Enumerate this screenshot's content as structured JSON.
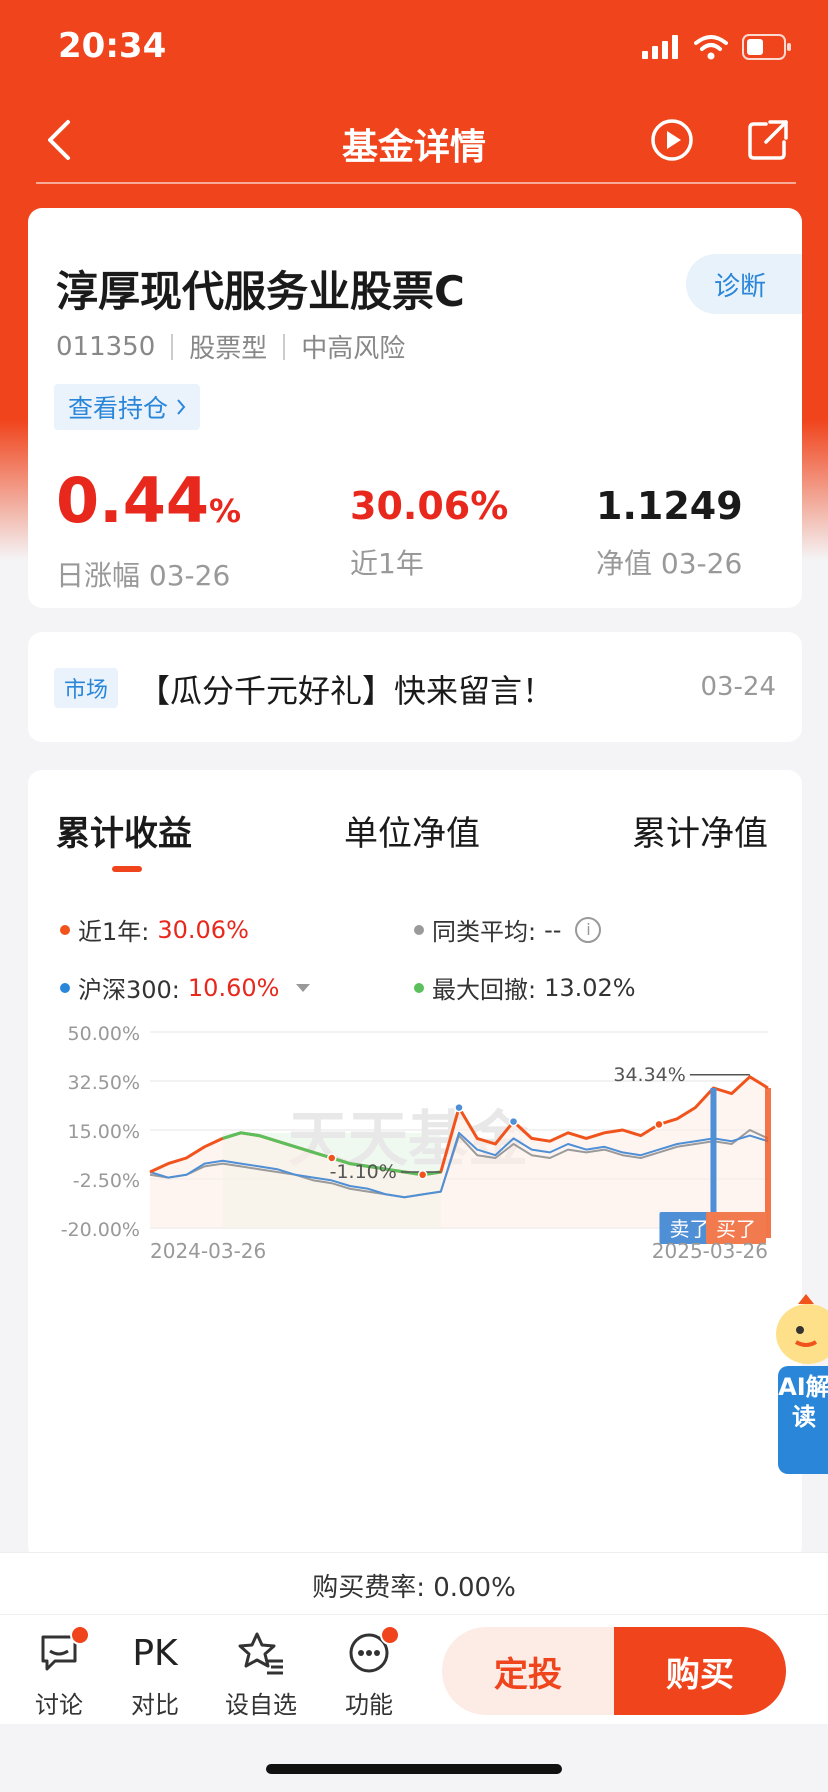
{
  "status": {
    "time": "20:34"
  },
  "nav": {
    "title": "基金详情",
    "back_icon": "chevron-left-icon",
    "play_icon": "play-circle-icon",
    "share_icon": "share-icon"
  },
  "fund": {
    "name": "淳厚现代服务业股票C",
    "code": "011350",
    "type": "股票型",
    "risk": "中高风险",
    "diagnose_label": "诊断",
    "holdings_label": "查看持仓"
  },
  "stats": {
    "daily_change": "0.44",
    "daily_change_unit": "%",
    "daily_change_label": "日涨幅 03-26",
    "one_year": "30.06%",
    "one_year_label": "近1年",
    "nav": "1.1249",
    "nav_label": "净值 03-26"
  },
  "news": {
    "tag": "市场",
    "title": "【瓜分千元好礼】快来留言！",
    "date": "03-24"
  },
  "chart_tabs": [
    "累计收益",
    "单位净值",
    "累计净值"
  ],
  "legend": {
    "fund_label": "近1年:",
    "fund_value": "30.06%",
    "peer_label": "同类平均:",
    "peer_value": "--",
    "index_label": "沪深300:",
    "index_value": "10.60%",
    "drawdown_label": "最大回撤:",
    "drawdown_value": "13.02%"
  },
  "chart_extra": {
    "watermark": "天天基金",
    "peak_label": "34.34%",
    "trough_label": "-1.10%",
    "sell_label": "卖了",
    "buy_label": "买了",
    "ai_label": "AI解读"
  },
  "chart_data": {
    "type": "line",
    "x_start": "2024-03-26",
    "x_end": "2025-03-26",
    "ylim": [
      -20,
      50
    ],
    "yticks": [
      "50.00%",
      "32.50%",
      "15.00%",
      "-2.50%",
      "-20.00%"
    ],
    "series": [
      {
        "name": "近1年",
        "color": "#f0541c",
        "values": [
          0,
          3,
          5,
          9,
          12,
          14,
          13,
          11,
          9,
          7,
          5,
          3,
          2,
          1,
          0,
          -1,
          0,
          23,
          12,
          10,
          18,
          12,
          11,
          14,
          12,
          14,
          15,
          13,
          17,
          19,
          23,
          30,
          28,
          34,
          30
        ]
      },
      {
        "name": "沪深300",
        "color": "#4f8fd6",
        "values": [
          0,
          -2,
          -1,
          3,
          4,
          3,
          2,
          1,
          -1,
          -2,
          -3,
          -5,
          -6,
          -8,
          -9,
          -8,
          -7,
          14,
          8,
          6,
          12,
          8,
          7,
          10,
          8,
          9,
          7,
          6,
          8,
          10,
          11,
          12,
          11,
          13,
          11
        ]
      },
      {
        "name": "同类平均",
        "color": "#9a9a9a",
        "values": [
          -1,
          -2,
          -1,
          2,
          3,
          2,
          1,
          0,
          -1,
          -3,
          -4,
          -6,
          -7,
          -8,
          -9,
          -8,
          -7,
          13,
          6,
          5,
          10,
          6,
          5,
          8,
          7,
          8,
          6,
          5,
          7,
          9,
          10,
          11,
          10,
          15,
          12
        ]
      }
    ]
  },
  "footer": {
    "fee_text": "购买费率: 0.00%",
    "items": [
      {
        "label": "讨论",
        "icon": "chat-bubble-icon"
      },
      {
        "label": "对比",
        "icon": "pk-icon",
        "glyph": "PK"
      },
      {
        "label": "设自选",
        "icon": "star-list-icon"
      },
      {
        "label": "功能",
        "icon": "more-dots-icon"
      }
    ],
    "plan_label": "定投",
    "buy_label": "购买"
  }
}
